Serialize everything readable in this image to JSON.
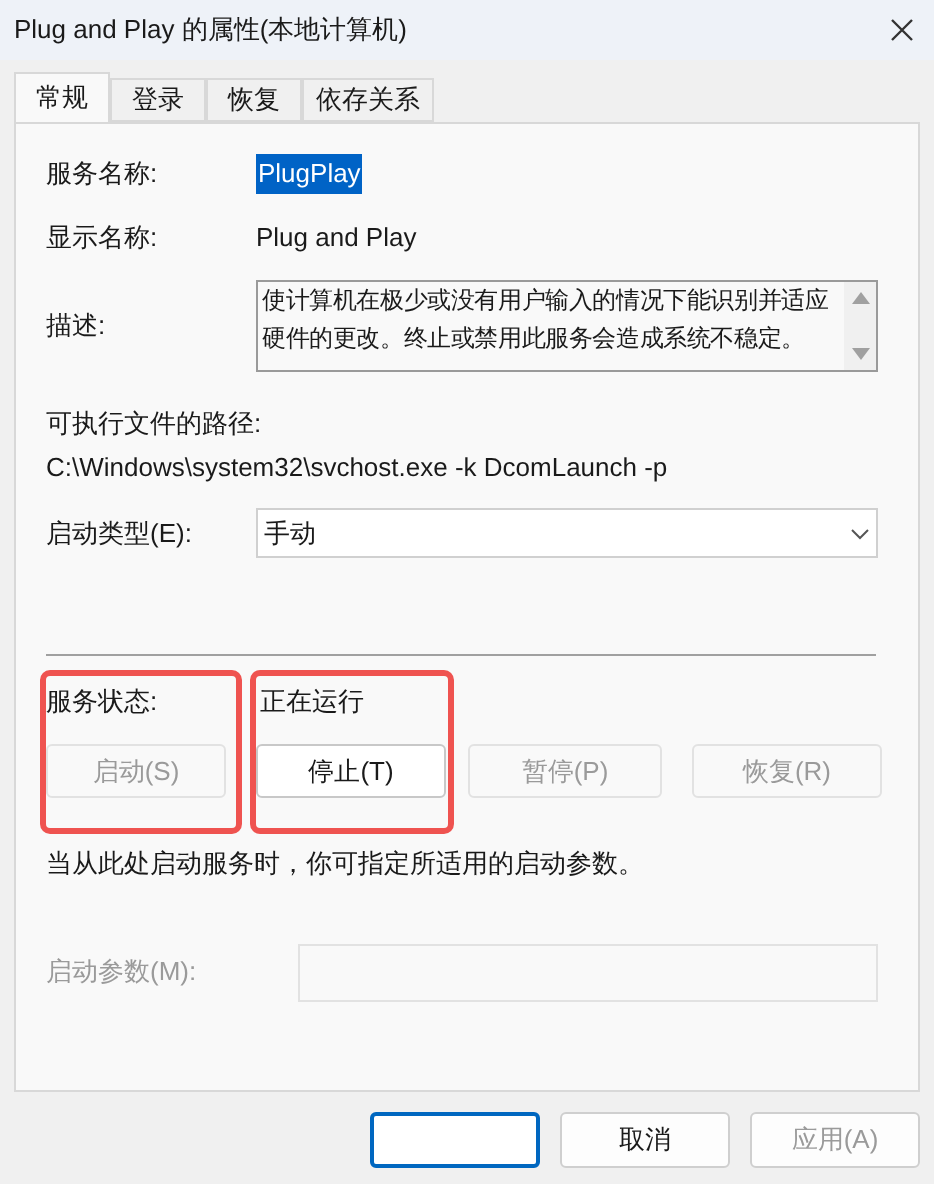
{
  "window": {
    "title": "Plug and Play 的属性(本地计算机)"
  },
  "tabs": [
    {
      "label": "常规",
      "selected": true
    },
    {
      "label": "登录",
      "selected": false
    },
    {
      "label": "恢复",
      "selected": false
    },
    {
      "label": "依存关系",
      "selected": false
    }
  ],
  "service_name": {
    "label": "服务名称:",
    "value": "PlugPlay",
    "selected": true
  },
  "display_name": {
    "label": "显示名称:",
    "value": "Plug and Play"
  },
  "description": {
    "label": "描述:",
    "value": "使计算机在极少或没有用户输入的情况下能识别并适应硬件的更改。终止或禁用此服务会造成系统不稳定。"
  },
  "executable_path": {
    "label": "可执行文件的路径:",
    "value": "C:\\Windows\\system32\\svchost.exe -k DcomLaunch -p"
  },
  "startup_type": {
    "label": "启动类型(E):",
    "value": "手动"
  },
  "service_status": {
    "label": "服务状态:",
    "value": "正在运行",
    "highlighted": true
  },
  "service_buttons": [
    {
      "label": "启动(S)",
      "disabled": true
    },
    {
      "label": "停止(T)",
      "disabled": false
    },
    {
      "label": "暂停(P)",
      "disabled": true
    },
    {
      "label": "恢复(R)",
      "disabled": true
    }
  ],
  "hint": "当从此处启动服务时，你可指定所适用的启动参数。",
  "start_parameters": {
    "label": "启动参数(M):",
    "disabled": true
  },
  "dialog_buttons": [
    {
      "kind": "default"
    },
    {
      "kind": "normal",
      "label": "取消",
      "disabled": false
    },
    {
      "kind": "normal",
      "label": "应用(A)",
      "disabled": true
    }
  ]
}
